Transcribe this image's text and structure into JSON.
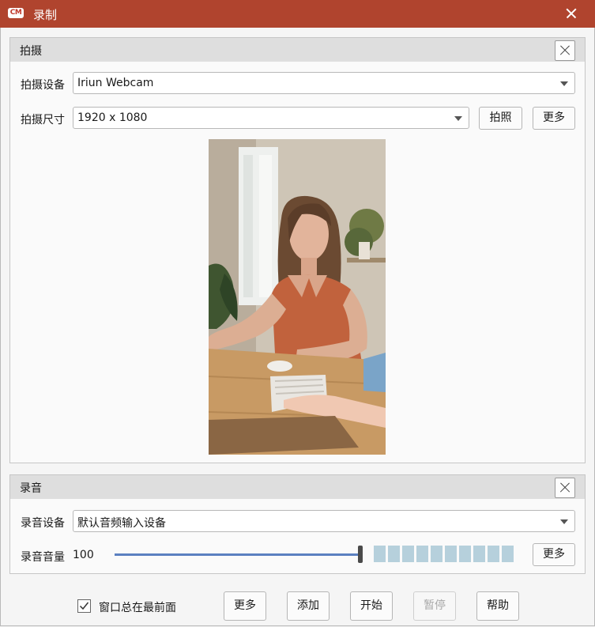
{
  "window": {
    "app_logo": "CM",
    "title": "录制"
  },
  "capture": {
    "title": "拍摄",
    "device_label": "拍摄设备",
    "device_value": "Iriun Webcam",
    "size_label": "拍摄尺寸",
    "size_value": "1920 x 1080",
    "snapshot_button": "拍照",
    "more_button": "更多"
  },
  "audio": {
    "title": "录音",
    "device_label": "录音设备",
    "device_value": "默认音频输入设备",
    "volume_label": "录音音量",
    "volume_value": "100",
    "volume_fraction": 1.0,
    "meter_segments": 10,
    "more_button": "更多"
  },
  "footer": {
    "always_on_top_label": "窗口总在最前面",
    "always_on_top_checked": true,
    "more_button": "更多",
    "add_button": "添加",
    "start_button": "开始",
    "pause_button": "暂停",
    "help_button": "帮助"
  },
  "colors": {
    "titlebar": "#b0442e",
    "slider_fill": "#5b80c0",
    "meter": "#b6d0dc"
  }
}
